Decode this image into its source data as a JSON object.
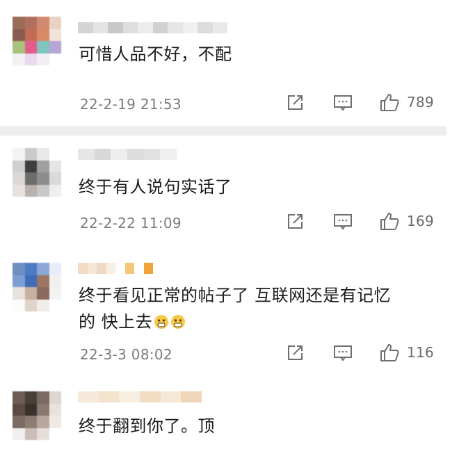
{
  "comments": [
    {
      "text_line1": "可惜人品不好，不配",
      "text_line2": "",
      "timestamp": "22-2-19 21:53",
      "likes": "789",
      "avatar_colors": [
        "#9a6d57",
        "#b06f5f",
        "#d08a6f",
        "#e9d2c3",
        "#8b5a50",
        "#c46a55",
        "#d88a66",
        "#f2e3da",
        "#a9c27c",
        "#e35d8a",
        "#7fc5c0",
        "#b5a6d6",
        "#f3f1f4",
        "#e8d9ee",
        "#f2eef4",
        "#ffffff"
      ],
      "name_colors": [
        "#d4d4d4",
        "#e4e4e4",
        "#c8c8c8",
        "#dedede",
        "#ececec",
        "#d1d1d1",
        "#e6e6e6",
        "#f0f0f0",
        "#dcdcdc",
        "#e9e9e9"
      ]
    },
    {
      "text_line1": "终于有人说句实话了",
      "text_line2": "",
      "timestamp": "22-2-22 11:09",
      "likes": "169",
      "avatar_colors": [
        "#f3f3f3",
        "#c9c9c9",
        "#e8e8e8",
        "#ffffff",
        "#cfcfcf",
        "#3e3e3e",
        "#a0a0a0",
        "#e5e5e5",
        "#ddd8d5",
        "#6c6c6c",
        "#8c8c8c",
        "#d9d9d9",
        "#e7e2df",
        "#b9b1ac",
        "#c8c8c8",
        "#eeeeee"
      ],
      "name_colors": [
        "#e6e6e6",
        "#d8d8d8",
        "#eeeeee",
        "#dddddd",
        "#e2e2e2",
        "#f0f0f0"
      ]
    },
    {
      "text_line1": "终于看见正常的帖子了 互联网还是有记忆",
      "text_line2": "的 快上去",
      "timestamp": "22-3-3 08:02",
      "likes": "116",
      "avatar_colors": [
        "#6d8fc0",
        "#4f7bc4",
        "#8aa7d6",
        "#e8eef7",
        "#7d9ed2",
        "#3f6bb7",
        "#9e7564",
        "#f0f0f0",
        "#e7e2dc",
        "#c7b0a1",
        "#8a6a5c",
        "#f3f3f3",
        "#fbfbfb",
        "#e0d3ca",
        "#f2ece8",
        "#ffffff"
      ],
      "name_colors": [
        "#f2dcc5",
        "#f5e7d7",
        "#eedac4",
        "#f7eee4",
        "#ffffff",
        "#f4c67a",
        "#ffffff",
        "#f2a33a"
      ]
    },
    {
      "text_line1": "终于翻到你了。顶",
      "text_line2": "",
      "timestamp": "",
      "likes": "",
      "avatar_colors": [
        "#6e5d55",
        "#4b3f3a",
        "#7b6a62",
        "#ddd6d1",
        "#5a4b45",
        "#3a302c",
        "#8a7970",
        "#e8e2de",
        "#7a6a62",
        "#8d7c73",
        "#b7a79d",
        "#efe9e5",
        "#efefef",
        "#c9bdb5",
        "#e5ddd8",
        "#ffffff"
      ],
      "name_colors": [
        "#f5ead9",
        "#f3e2cc",
        "#f7eee2",
        "#f2ddc2",
        "#f6e8d6",
        "#efd6b8"
      ]
    }
  ],
  "icons": {
    "share": "share-icon",
    "reply": "comment-icon",
    "like": "thumbs-up-icon"
  },
  "emoji": "grimacing-face-emoji"
}
